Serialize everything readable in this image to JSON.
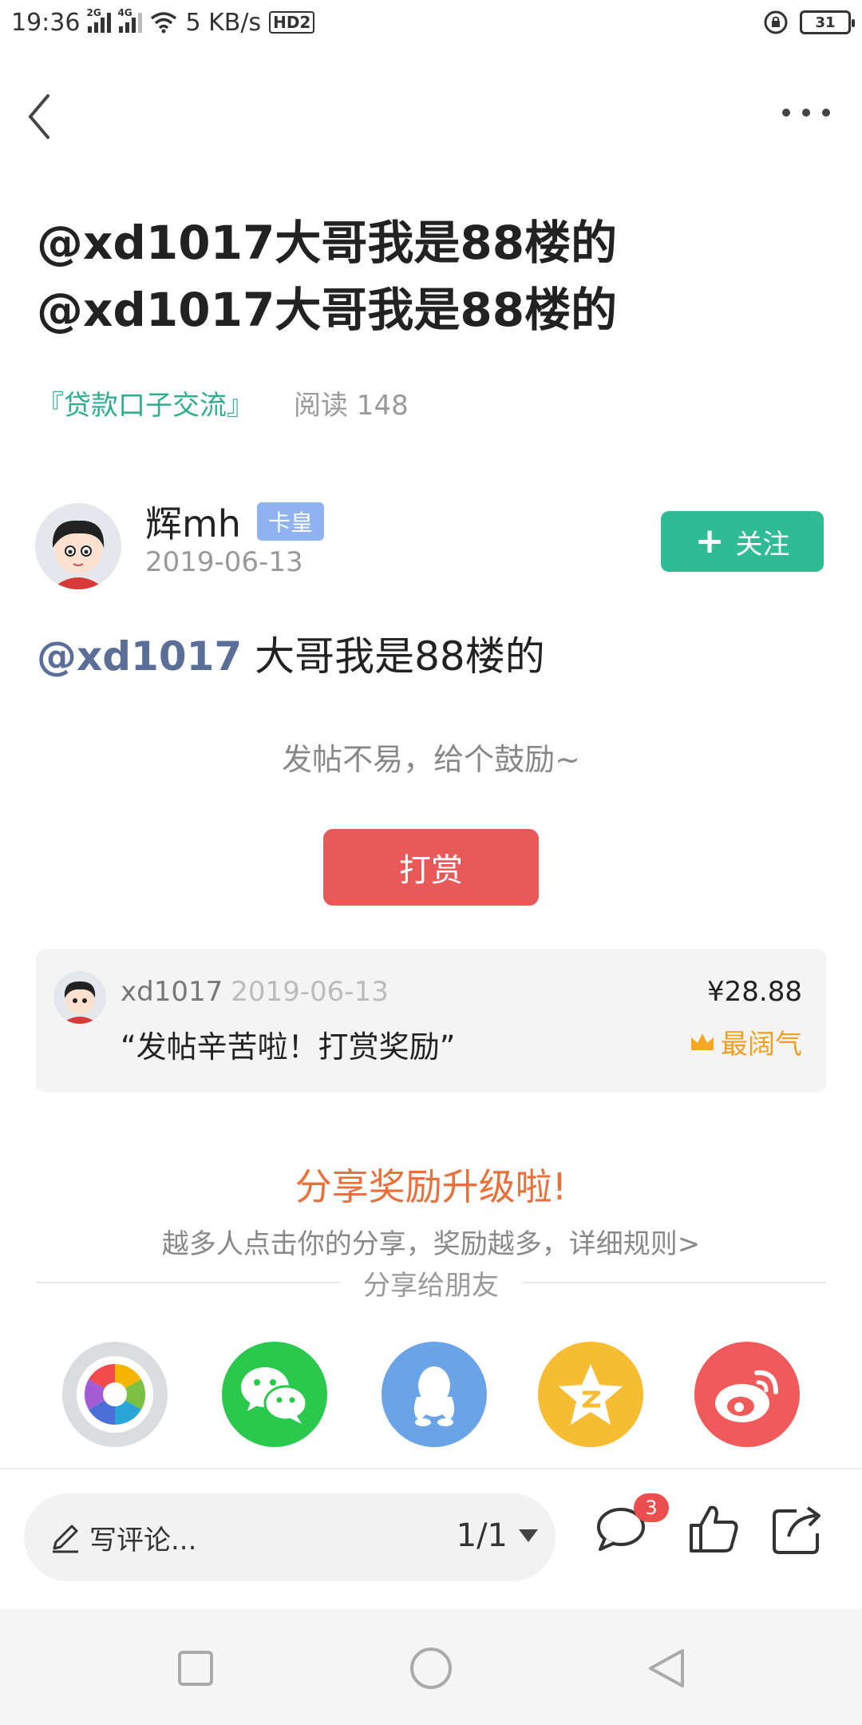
{
  "status_bar": {
    "time": "19:36",
    "net_2g": "2G",
    "net_4g": "4G",
    "speed": "5 KB/s",
    "hd": "HD2",
    "battery": "31"
  },
  "nav": {
    "back_icon": "chevron-left-icon",
    "more_icon": "more-dots-icon"
  },
  "post": {
    "title": "@xd1017大哥我是88楼的@xd1017大哥我是88楼的",
    "forum": "『贷款口子交流』",
    "reads": "阅读 148",
    "author": {
      "name": "辉mh",
      "badge": "卡皇",
      "date": "2019-06-13"
    },
    "follow_label": "关注",
    "mention": "@xd1017",
    "body": " 大哥我是88楼的"
  },
  "reward": {
    "encourage_text": "发帖不易，给个鼓励~",
    "button_label": "打赏",
    "record": {
      "user": "xd1017",
      "date": "2019-06-13",
      "message": "“发帖辛苦啦！打赏奖励”",
      "amount": "¥28.88",
      "tag": "最阔气"
    }
  },
  "share": {
    "title": "分享奖励升级啦!",
    "subtitle": "越多人点击你的分享，奖励越多，详细规则>",
    "divider_label": "分享给朋友",
    "targets": [
      "moments",
      "wechat",
      "qq",
      "qzone",
      "weibo"
    ]
  },
  "bottom_bar": {
    "comment_placeholder": "写评论...",
    "page_indicator": "1/1",
    "comment_count": "3"
  },
  "colors": {
    "accent_green": "#2fbb94",
    "reward_red": "#e85a5a",
    "share_orange": "#e8703a",
    "mention_blue": "#5b6e97"
  }
}
